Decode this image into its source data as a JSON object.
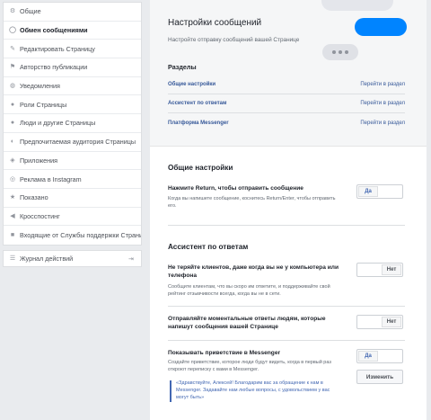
{
  "sidebar": {
    "items": [
      {
        "icon": "gear-icon",
        "glyph": "⚙",
        "label": "Общие"
      },
      {
        "icon": "messenger-icon",
        "glyph": "◯",
        "label": "Обмен сообщениями"
      },
      {
        "icon": "pencil-icon",
        "glyph": "✎",
        "label": "Редактировать Страницу"
      },
      {
        "icon": "flag-icon",
        "glyph": "⚑",
        "label": "Авторство публикации"
      },
      {
        "icon": "globe-icon",
        "glyph": "◍",
        "label": "Уведомления"
      },
      {
        "icon": "person-icon",
        "glyph": "●",
        "label": "Роли Страницы"
      },
      {
        "icon": "people-icon",
        "glyph": "●",
        "label": "Люди и другие Страницы"
      },
      {
        "icon": "audience-icon",
        "glyph": "◐",
        "label": "Предпочитаемая аудитория Страницы"
      },
      {
        "icon": "apps-icon",
        "glyph": "◈",
        "label": "Приложения"
      },
      {
        "icon": "instagram-icon",
        "glyph": "◎",
        "label": "Реклама в Instagram"
      },
      {
        "icon": "star-icon",
        "glyph": "★",
        "label": "Показано"
      },
      {
        "icon": "crosspost-icon",
        "glyph": "◀",
        "label": "Кросспостинг"
      },
      {
        "icon": "support-inbox-icon",
        "glyph": "■",
        "label": "Входящие от Службы поддержки Страни"
      }
    ],
    "activity_log": {
      "icon": "list-icon",
      "glyph": "☰",
      "label": "Журнал действий",
      "export_glyph": "⇥"
    }
  },
  "hero": {
    "title": "Настройки сообщений",
    "subtitle": "Настройте отправку сообщений вашей Странице"
  },
  "sections": {
    "title": "Разделы",
    "items": [
      {
        "name": "Общие настройки",
        "link": "Перейти в раздел"
      },
      {
        "name": "Ассистент по ответам",
        "link": "Перейти в раздел"
      },
      {
        "name": "Платформа Messenger",
        "link": "Перейти в раздел"
      }
    ]
  },
  "general": {
    "heading": "Общие настройки",
    "return_title": "Нажмите Return, чтобы отправить сообщение",
    "return_desc": "Когда вы напишете сообщение, коснитесь Return/Enter, чтобы отправить его.",
    "return_toggle": "Да"
  },
  "assistant": {
    "heading": "Ассистент по ответам",
    "away_title": "Не теряйте клиентов, даже когда вы не у компьютера или телефона",
    "away_desc": "Сообщите клиентам, что вы скоро им ответите, и поддерживайте свой рейтинг отзывчивости всегда, когда вы не в сети.",
    "away_toggle": "Нет",
    "instant_title": "Отправляйте моментальные ответы людям, которые напишут сообщения вашей Странице",
    "instant_toggle": "Нет",
    "greeting_title": "Показывать приветствие в Messenger",
    "greeting_desc": "Создайте приветствие, которое люди будут видеть, когда в первый раз откроют переписку с вами в Messenger.",
    "greeting_toggle": "Да",
    "edit_label": "Изменить",
    "greeting_text": "«Здравствуйте, Алексей! Благодарим вас за обращение к нам в Messenger. Задавайте нам любые вопросы, с удовольствием у вас могут быть»"
  }
}
